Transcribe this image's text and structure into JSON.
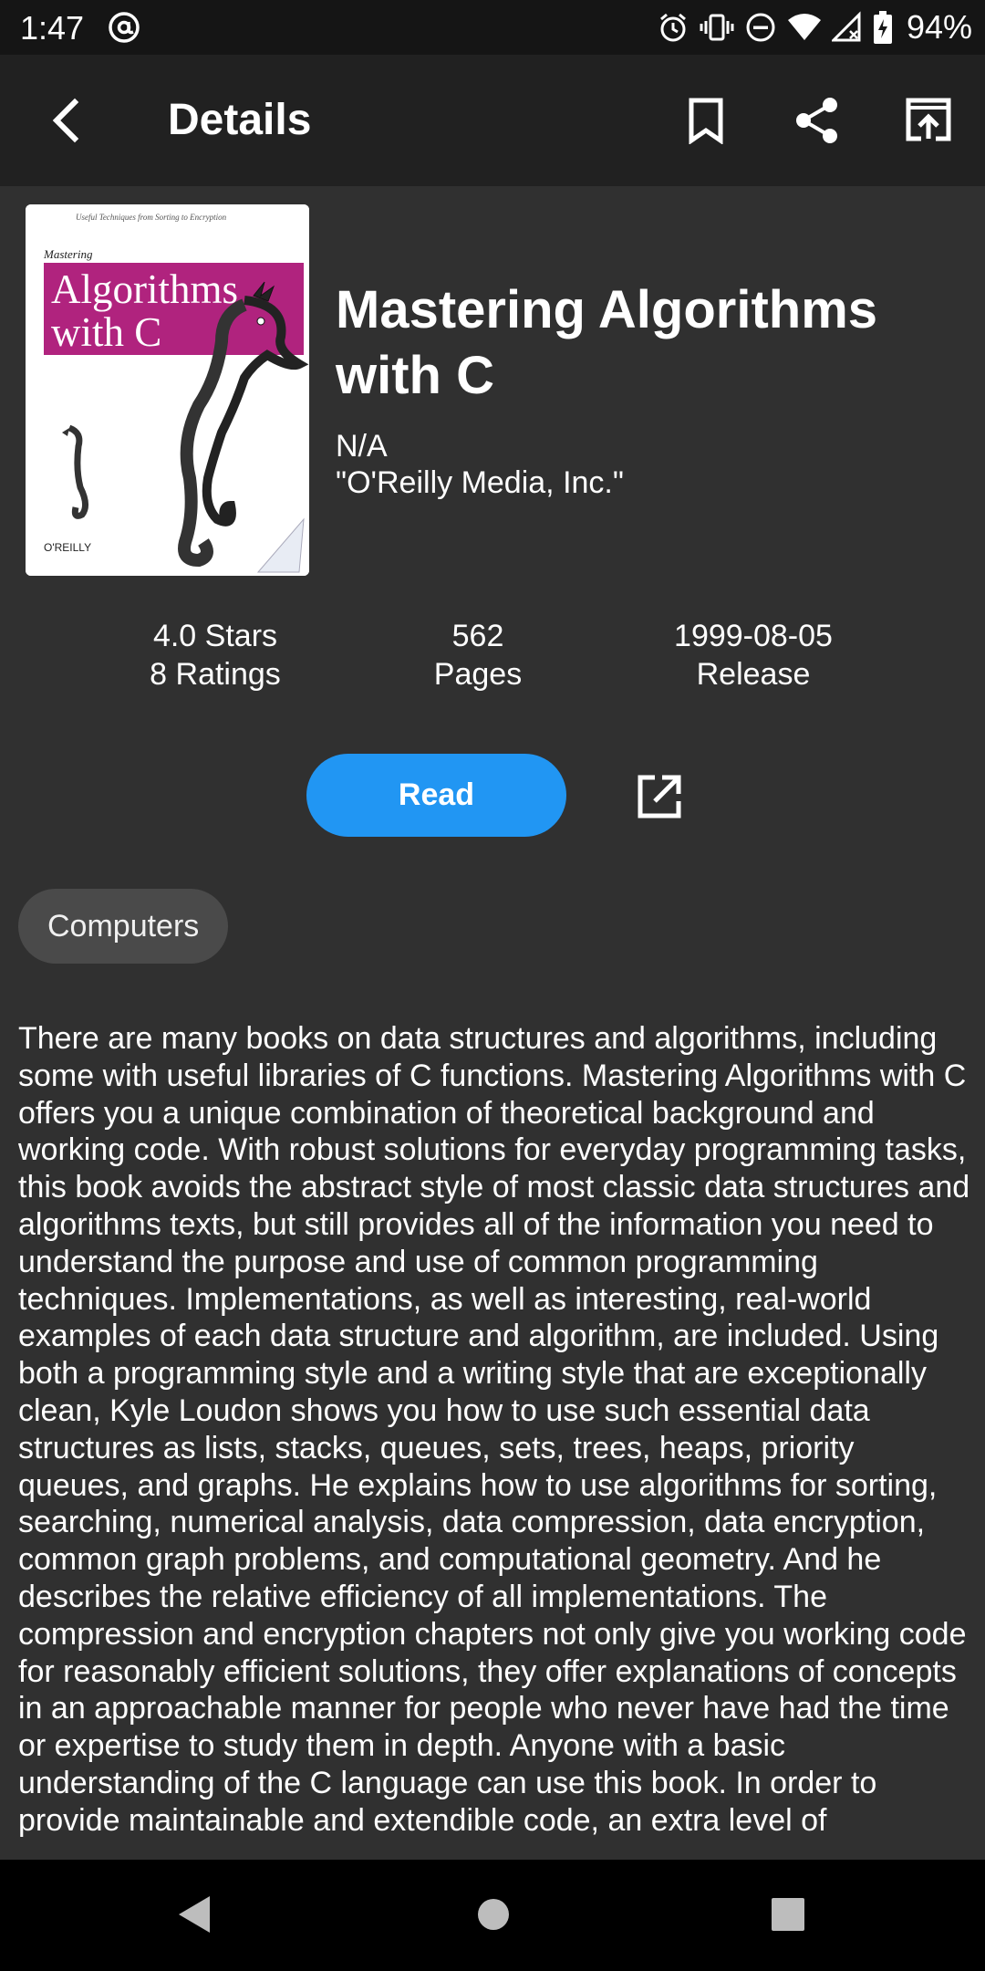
{
  "status_bar": {
    "time": "1:47",
    "battery": "94%",
    "icons": [
      "at-sign-icon",
      "alarm-icon",
      "vibrate-icon",
      "do-not-disturb-icon",
      "wifi-icon",
      "cellular-icon",
      "battery-charging-icon"
    ]
  },
  "app_bar": {
    "title": "Details",
    "icons": [
      "back-arrow-icon",
      "bookmark-icon",
      "share-icon",
      "open-in-browser-icon"
    ]
  },
  "book": {
    "cover": {
      "subtitle": "Useful Techniques from Sorting to Encryption",
      "word1": "Mastering",
      "title_line1": "Algorithms",
      "title_line2": "with C",
      "publisher_logo": "O'REILLY"
    },
    "title": "Mastering Algorithms with C",
    "author": "N/A",
    "publisher": "\"O'Reilly Media, Inc.\""
  },
  "stats": {
    "rating_value": "4.0 Stars",
    "rating_count": "8 Ratings",
    "pages_value": "562",
    "pages_label": "Pages",
    "release_value": "1999-08-05",
    "release_label": "Release"
  },
  "actions": {
    "read_label": "Read",
    "open_icon": "open-in-new-icon"
  },
  "categories": [
    "Computers"
  ],
  "description": "There are many books on data structures and algorithms, including some with useful libraries of C functions. Mastering Algorithms with C offers you a unique combination of theoretical background and working code. With robust solutions for everyday programming tasks, this book avoids the abstract style of most classic data structures and algorithms texts, but still provides all of the information you need to understand the purpose and use of common programming techniques. Implementations, as well as interesting, real-world examples of each data structure and algorithm, are included. Using both a programming style and a writing style that are exceptionally clean, Kyle Loudon shows you how to use such essential data structures as lists, stacks, queues, sets, trees, heaps, priority queues, and graphs. He explains how to use algorithms for sorting, searching, numerical analysis, data compression, data encryption, common graph problems, and computational geometry. And he describes the relative efficiency of all implementations. The compression and encryption chapters not only give you working code for reasonably efficient solutions, they offer explanations of concepts in an approachable manner for people who never have had the time or expertise to study them in depth. Anyone with a basic understanding of the C language can use this book. In order to provide maintainable and extendible code, an extra level of",
  "nav_bar": {
    "icons": [
      "nav-back-icon",
      "nav-home-icon",
      "nav-recents-icon"
    ]
  },
  "colors": {
    "background": "#303030",
    "app_bar": "#212121",
    "accent": "#2196f3",
    "chip": "#4a4a4a",
    "cover_magenta": "#b0237e"
  }
}
